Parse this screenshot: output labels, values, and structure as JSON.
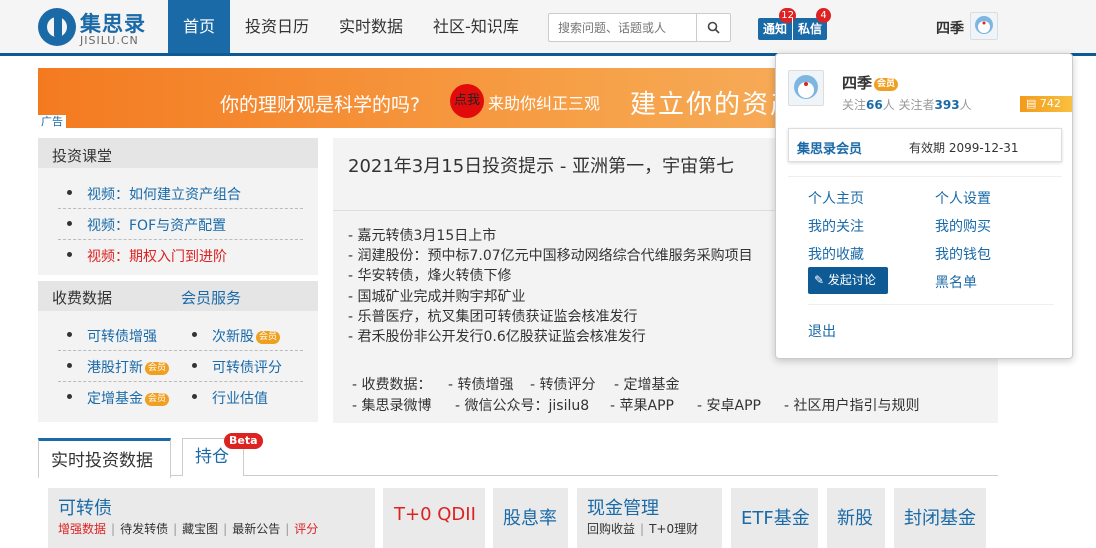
{
  "logo": {
    "cn": "集思录",
    "en": "JISILU.CN"
  },
  "nav": [
    "首页",
    "投资日历",
    "实时数据",
    "社区-知识库"
  ],
  "search": {
    "placeholder": "搜索问题、话题或人"
  },
  "notify": {
    "label": "通知",
    "count": "12"
  },
  "pm": {
    "label": "私信",
    "count": "4"
  },
  "user": {
    "name": "四季"
  },
  "banner": {
    "question": "你的理财观是科学的吗?",
    "dot": "点我",
    "help": "来助你纠正三观",
    "big": "建立你的资产",
    "ad": "广告"
  },
  "course": {
    "title": "投资课堂",
    "items": [
      "视频：如何建立资产组合",
      "视频：FOF与资产配置",
      "视频：期权入门到进阶"
    ]
  },
  "paid": {
    "title": "收费数据",
    "member_title": "会员服务",
    "items": [
      "可转债增强",
      "次新股",
      "港股打新",
      "可转债评分",
      "定增基金",
      "行业估值"
    ],
    "vip": "会员"
  },
  "article": {
    "title": "2021年3月15日投资提示 - 亚洲第一，宇宙第七",
    "bullets": [
      "- 嘉元转债3月15日上市",
      "- 润建股份：预中标7.07亿元中国移动网络综合代维服务采购项目",
      "- 华安转债，烽火转债下修",
      "- 国城矿业完成并购宇邦矿业",
      "- 乐普医疗，杭叉集团可转债获证监会核准发行",
      "- 君禾股份非公开发行0.6亿股获证监会核准发行"
    ],
    "quick": {
      "paid_label": "- 收费数据：",
      "l1": "- 转债增强",
      "l2": "- 转债评分",
      "l3": "- 定增基金",
      "l4": "- 集思录微博",
      "l5": "- 微信公众号：jisilu8",
      "l6": "- 苹果APP",
      "l7": "- 安卓APP",
      "l8": "- 社区用户指引与规则"
    }
  },
  "tabs": {
    "t1": "实时投资数据",
    "t2": "持仓",
    "beta": "Beta"
  },
  "cards": {
    "cb": {
      "title": "可转债",
      "s1": "增强数据",
      "s2": "待发转债",
      "s3": "藏宝图",
      "s4": "最新公告",
      "s5": "评分",
      "sep": "|"
    },
    "qdii": "T+0 QDII",
    "div": "股息率",
    "cash": {
      "title": "现金管理",
      "s1": "回购收益",
      "s2": "T+0理财"
    },
    "etf": "ETF基金",
    "ipo": "新股",
    "closed": "封闭基金"
  },
  "dropdown": {
    "name": "四季",
    "vip": "会员",
    "follow_pre": "关注",
    "follow_n": "66",
    "follow_mid": "人 关注者",
    "fans_n": "393",
    "follow_post": "人",
    "score": "742",
    "member": "集思录会员",
    "valid": "有效期 2099-12-31",
    "links": [
      "个人主页",
      "个人设置",
      "我的关注",
      "我的购买",
      "我的收藏",
      "我的钱包",
      "黑名单"
    ],
    "post_btn": "发起讨论",
    "logout": "退出"
  }
}
